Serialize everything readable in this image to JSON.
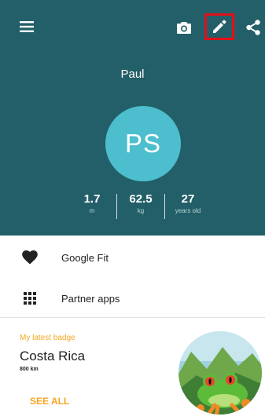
{
  "profile": {
    "name": "Paul",
    "initials": "PS",
    "stats": [
      {
        "value": "1.7",
        "unit": "m"
      },
      {
        "value": "62.5",
        "unit": "kg"
      },
      {
        "value": "27",
        "unit": "years old"
      }
    ]
  },
  "toolbar": {
    "icons": [
      "menu-icon",
      "camera-icon",
      "edit-icon",
      "share-icon"
    ]
  },
  "menu": {
    "items": [
      {
        "label": "Google Fit",
        "icon": "heart-icon"
      },
      {
        "label": "Partner apps",
        "icon": "apps-grid-icon"
      }
    ]
  },
  "badge": {
    "section_title": "My latest badge",
    "name": "Costa Rica",
    "distance": "800 km",
    "see_all": "SEE ALL"
  },
  "colors": {
    "header_bg": "#235f68",
    "avatar_bg": "#4cbecd",
    "accent": "#f5a623",
    "highlight": "#e0101a"
  }
}
